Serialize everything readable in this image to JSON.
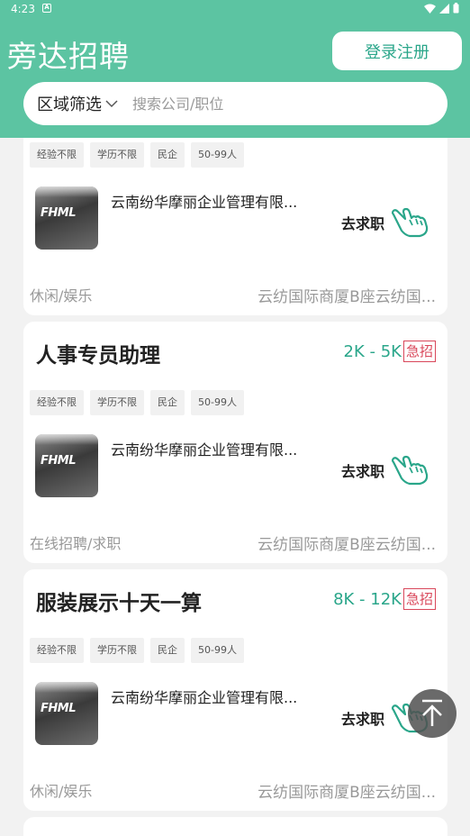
{
  "status_bar": {
    "time": "4:23",
    "notification": "A"
  },
  "header": {
    "title": "旁达招聘",
    "login_label": "登录注册"
  },
  "search": {
    "region_label": "区域筛选",
    "placeholder": "搜索公司/职位"
  },
  "colors": {
    "brand": "#5cc4a2",
    "accent": "#2aa68a",
    "urgent": "#d9475a"
  },
  "jobs": [
    {
      "title": "",
      "salary": "",
      "urgent": "",
      "tags": [
        "经验不限",
        "学历不限",
        "民企",
        "50-99人"
      ],
      "company": "云南纷华摩丽企业管理有限...",
      "apply_label": "去求职",
      "category": "休闲/娱乐",
      "address": "云纺国际商厦B座云纺国..."
    },
    {
      "title": "人事专员助理",
      "salary": "2K - 5K",
      "urgent": "急招",
      "tags": [
        "经验不限",
        "学历不限",
        "民企",
        "50-99人"
      ],
      "company": "云南纷华摩丽企业管理有限...",
      "apply_label": "去求职",
      "category": "在线招聘/求职",
      "address": "云纺国际商厦B座云纺国..."
    },
    {
      "title": "服装展示十天一算",
      "salary": "8K - 12K",
      "urgent": "急招",
      "tags": [
        "经验不限",
        "学历不限",
        "民企",
        "50-99人"
      ],
      "company": "云南纷华摩丽企业管理有限...",
      "apply_label": "去求职",
      "category": "休闲/娱乐",
      "address": "云纺国际商厦B座云纺国..."
    }
  ],
  "logo_text": "FHML",
  "icons": {
    "hand": "hand-pointer-icon",
    "back_to_top": "arrow-up-icon"
  }
}
